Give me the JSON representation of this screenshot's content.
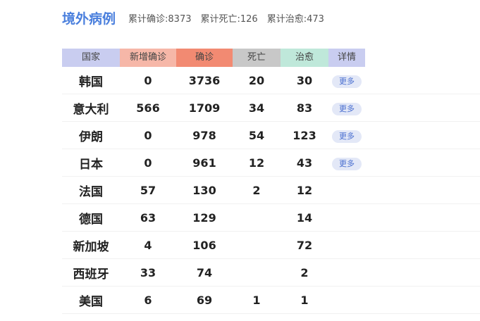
{
  "header": {
    "title": "境外病例",
    "stats": [
      {
        "label": "累计确诊:",
        "value": "8373"
      },
      {
        "label": "累计死亡:",
        "value": "126"
      },
      {
        "label": "累计治愈:",
        "value": "473"
      }
    ]
  },
  "table": {
    "columns": [
      "国家",
      "新增确诊",
      "确诊",
      "死亡",
      "治愈",
      "详情"
    ],
    "header_colors": [
      "#c9cdf0",
      "#f6b7a8",
      "#f28a72",
      "#c8c8c8",
      "#bfe8da",
      "#c9cdf0"
    ],
    "more_label": "更多",
    "rows": [
      {
        "country": "韩国",
        "new": "0",
        "confirmed": "3736",
        "deaths": "20",
        "cured": "30",
        "has_more": true
      },
      {
        "country": "意大利",
        "new": "566",
        "confirmed": "1709",
        "deaths": "34",
        "cured": "83",
        "has_more": true
      },
      {
        "country": "伊朗",
        "new": "0",
        "confirmed": "978",
        "deaths": "54",
        "cured": "123",
        "has_more": true
      },
      {
        "country": "日本",
        "new": "0",
        "confirmed": "961",
        "deaths": "12",
        "cured": "43",
        "has_more": true
      },
      {
        "country": "法国",
        "new": "57",
        "confirmed": "130",
        "deaths": "2",
        "cured": "12",
        "has_more": false
      },
      {
        "country": "德国",
        "new": "63",
        "confirmed": "129",
        "deaths": "",
        "cured": "14",
        "has_more": false
      },
      {
        "country": "新加坡",
        "new": "4",
        "confirmed": "106",
        "deaths": "",
        "cured": "72",
        "has_more": false
      },
      {
        "country": "西班牙",
        "new": "33",
        "confirmed": "74",
        "deaths": "",
        "cured": "2",
        "has_more": false
      },
      {
        "country": "美国",
        "new": "6",
        "confirmed": "69",
        "deaths": "1",
        "cured": "1",
        "has_more": false
      }
    ]
  }
}
